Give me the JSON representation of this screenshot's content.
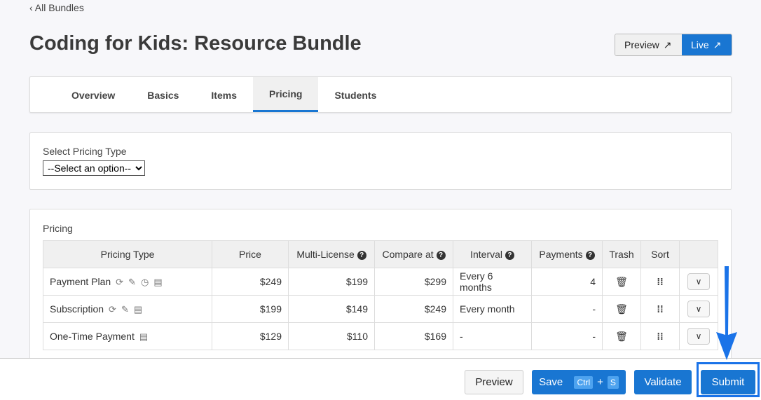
{
  "back_link": "All Bundles",
  "title": "Coding for Kids: Resource Bundle",
  "top_buttons": {
    "preview": "Preview",
    "live": "Live"
  },
  "tabs": [
    "Overview",
    "Basics",
    "Items",
    "Pricing",
    "Students"
  ],
  "active_tab": "Pricing",
  "select_pricing": {
    "label": "Select Pricing Type",
    "value": "--Select an option--"
  },
  "pricing": {
    "label": "Pricing",
    "columns": [
      "Pricing Type",
      "Price",
      "Multi-License",
      "Compare at",
      "Interval",
      "Payments",
      "Trash",
      "Sort",
      ""
    ],
    "rows": [
      {
        "type": "Payment Plan",
        "icons": [
          "sync-icon",
          "pencil-icon",
          "clock-icon",
          "invoice-icon"
        ],
        "price": "$249",
        "multi": "$199",
        "compare": "$299",
        "interval": "Every 6 months",
        "payments": "4"
      },
      {
        "type": "Subscription",
        "icons": [
          "sync-icon",
          "pencil-icon",
          "invoice-icon"
        ],
        "price": "$199",
        "multi": "$149",
        "compare": "$249",
        "interval": "Every month",
        "payments": "-"
      },
      {
        "type": "One-Time Payment",
        "icons": [
          "invoice-icon"
        ],
        "price": "$129",
        "multi": "$110",
        "compare": "$169",
        "interval": "-",
        "payments": "-"
      }
    ]
  },
  "footer": {
    "preview": "Preview",
    "save": "Save",
    "kbd_ctrl": "Ctrl",
    "kbd_plus": "+",
    "kbd_s": "S",
    "validate": "Validate",
    "submit": "Submit"
  },
  "colors": {
    "primary": "#1976d2",
    "highlight": "#1a73e8"
  }
}
